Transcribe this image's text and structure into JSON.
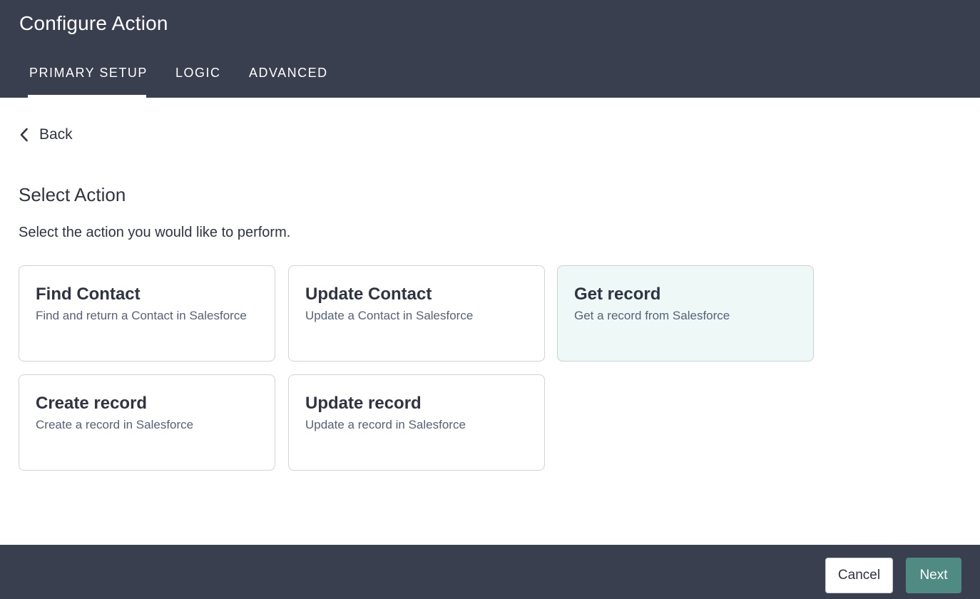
{
  "header": {
    "title": "Configure Action",
    "tabs": [
      {
        "label": "PRIMARY SETUP",
        "active": true
      },
      {
        "label": "LOGIC",
        "active": false
      },
      {
        "label": "ADVANCED",
        "active": false
      }
    ]
  },
  "back": {
    "label": "Back",
    "icon": "chevron-left-icon"
  },
  "section": {
    "title": "Select Action",
    "description": "Select the action you would like to perform."
  },
  "actions": [
    {
      "title": "Find Contact",
      "description": "Find and return a Contact in Salesforce",
      "selected": false
    },
    {
      "title": "Update Contact",
      "description": "Update a Contact in Salesforce",
      "selected": false
    },
    {
      "title": "Get record",
      "description": "Get a record from Salesforce",
      "selected": true
    },
    {
      "title": "Create record",
      "description": "Create a record in Salesforce",
      "selected": false
    },
    {
      "title": "Update record",
      "description": "Update a record in Salesforce",
      "selected": false
    }
  ],
  "footer": {
    "cancel_label": "Cancel",
    "next_label": "Next"
  },
  "colors": {
    "header_bg": "#3a3f4f",
    "selected_card_bg": "#eef8f7",
    "primary_button": "#4f8a83",
    "text": "#2e3442",
    "muted_text": "#55627a"
  }
}
